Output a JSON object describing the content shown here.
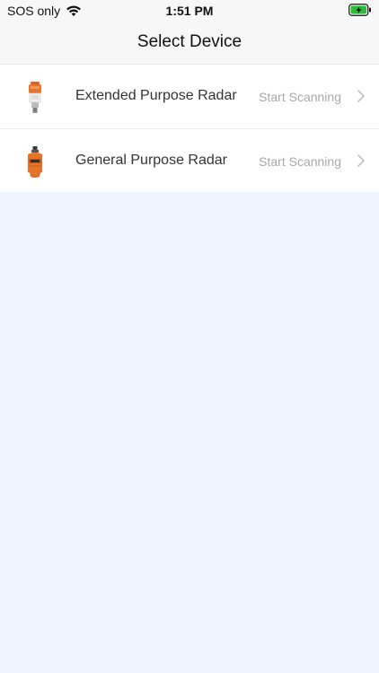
{
  "status_bar": {
    "carrier": "SOS only",
    "time": "1:51 PM",
    "wifi_icon": "wifi-icon",
    "battery_icon": "battery-charging-icon",
    "battery_color": "#2bbd3a"
  },
  "nav": {
    "title": "Select Device"
  },
  "devices": [
    {
      "label": "Extended Purpose Radar",
      "action": "Start Scanning",
      "image_icon": "extended-radar-device-image",
      "chevron_icon": "chevron-right-icon"
    },
    {
      "label": "General Purpose Radar",
      "action": "Start Scanning",
      "image_icon": "general-radar-device-image",
      "chevron_icon": "chevron-right-icon"
    }
  ],
  "colors": {
    "background": "#eef5fc",
    "bar_background": "#f7f7f7",
    "row_background": "#ffffff",
    "action_text": "#a8a8a8",
    "device_orange": "#e8732a"
  }
}
